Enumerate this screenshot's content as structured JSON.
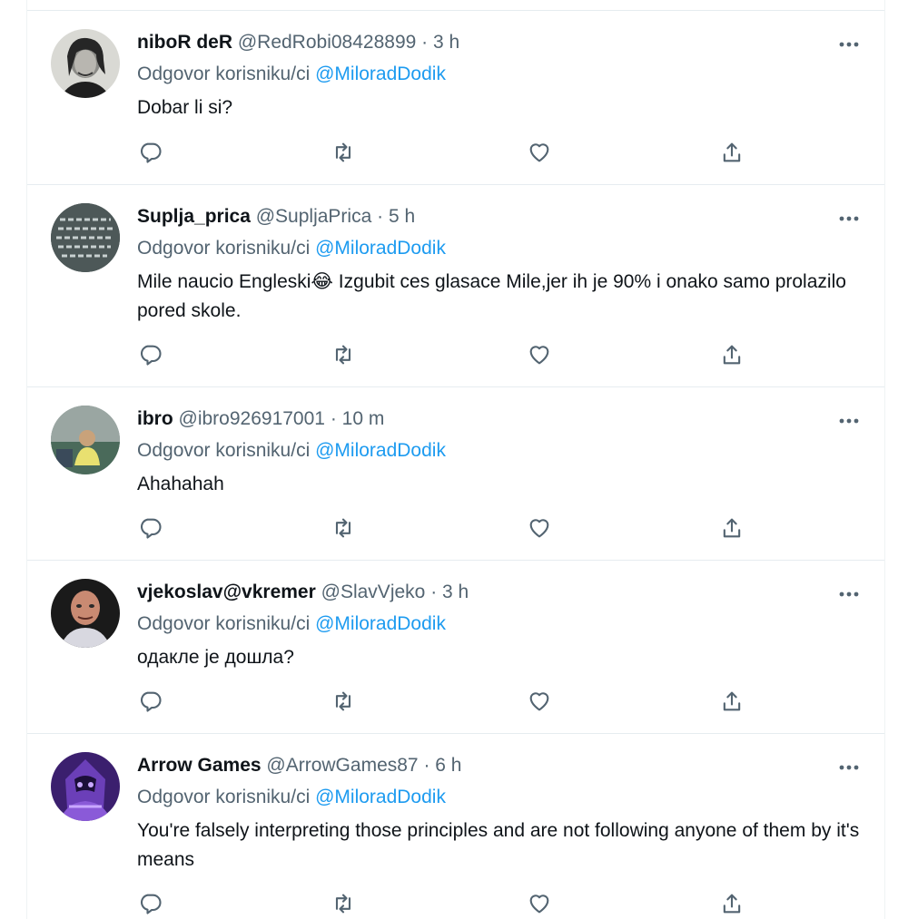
{
  "reply_prefix": "Odgovor korisniku/ci",
  "reply_to": "@MiloradDodik",
  "separator": "·",
  "more_label": "•••",
  "tweets": [
    {
      "name": "niboR deR",
      "handle": "@RedRobi08428899",
      "time": "3 h",
      "text": "Dobar li si?"
    },
    {
      "name": "Suplja_prica",
      "handle": "@SupljaPrica",
      "time": "5 h",
      "text": "Mile naucio Engleski😂 Izgubit ces glasace Mile,jer ih je 90% i onako samo prolazilo pored skole."
    },
    {
      "name": "ibro",
      "handle": "@ibro926917001",
      "time": "10 m",
      "text": "Ahahahah"
    },
    {
      "name": "vjekoslav@vkremer",
      "handle": "@SlavVjeko",
      "time": "3 h",
      "text": "одакле је дошла?"
    },
    {
      "name": "Arrow Games",
      "handle": "@ArrowGames87",
      "time": "6 h",
      "text": "You're falsely interpreting those principles and are not following anyone of them by it's means"
    }
  ],
  "colors": {
    "text": "#0f1419",
    "secondary": "#536471",
    "mention": "#1d9bf0",
    "border": "#e6ecf0"
  },
  "icons": [
    "reply-icon",
    "retweet-icon",
    "like-icon",
    "share-icon",
    "more-icon"
  ]
}
